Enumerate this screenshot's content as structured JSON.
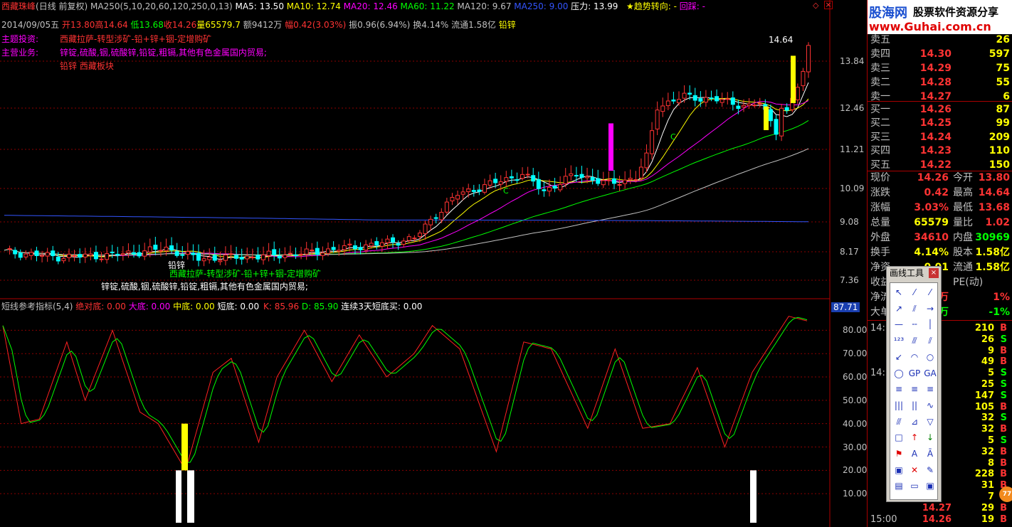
{
  "header": {
    "stock_name": "西藏珠峰",
    "period": "(日线 前复权)",
    "ma_params": "MA250(5,10,20,60,120,250,0,13)",
    "ma5": "MA5: 13.50",
    "ma10": "MA10: 12.74",
    "ma20": "MA20: 12.46",
    "ma60": "MA60: 11.22",
    "ma120": "MA120: 9.67",
    "ma250": "MA250: 9.00",
    "pressure": "压力: 13.99",
    "trend": "★趋势转向: -",
    "follow": "回踩: -"
  },
  "daybar": {
    "date": "2014/09/05五",
    "open": "开13.80",
    "high": "高14.64",
    "low": "低13.68",
    "close": "收14.26",
    "volume": "量65579.7",
    "amount": "额9412万",
    "change": "幅0.42(3.03%)",
    "amplitude": "振0.96(6.94%)",
    "turnover": "换4.14%",
    "float_cap": "流通1.58亿",
    "sector": "铅锌"
  },
  "notes": {
    "theme_label": "主题投资:",
    "theme_text": "西藏拉萨-转型涉矿-铅+锌+铟-定增购矿",
    "business_label": "主营业务:",
    "business_text": "锌锭,硫酸,铟,硫酸锌,铅锭,粗镉,其他有色金属国内贸易;",
    "blocks_text": "铅锌 西藏板块",
    "chart_tag": "铅锌",
    "chart_theme": "西藏拉萨-转型涉矿-铅+锌+铟-定增购矿",
    "chart_business": "锌锭,硫酸,铟,硫酸锌,铅锭,粗镉,其他有色金属国内贸易;",
    "peak_label": "14.64",
    "c_marker": "C"
  },
  "price_axis": {
    "ticks": [
      "13.84",
      "12.46",
      "11.21",
      "10.09",
      "9.08",
      "8.17",
      "7.36"
    ]
  },
  "indicator": {
    "name": "短线参考指标(5,4)",
    "abs_bottom": "绝对底: 0.00",
    "big_bottom": "大底: 0.00",
    "mid_bottom": "中底: 0.00",
    "short_bottom": "短底: 0.00",
    "k": "K: 85.96",
    "d": "D: 85.90",
    "buy3": "连续3天短底买: 0.00",
    "current": "87.71",
    "ticks": [
      "80.00",
      "70.00",
      "60.00",
      "50.00",
      "40.00",
      "30.00",
      "20.00",
      "10.00"
    ]
  },
  "logo": {
    "cn": "股海网",
    "slogan": "股票软件资源分享",
    "url": "www.Guhai.com.cn"
  },
  "orderbook": {
    "asks": [
      {
        "label": "卖五",
        "price": "",
        "vol": "26"
      },
      {
        "label": "卖四",
        "price": "14.30",
        "vol": "597"
      },
      {
        "label": "卖三",
        "price": "14.29",
        "vol": "75"
      },
      {
        "label": "卖二",
        "price": "14.28",
        "vol": "55"
      },
      {
        "label": "卖一",
        "price": "14.27",
        "vol": "6"
      }
    ],
    "bids": [
      {
        "label": "买一",
        "price": "14.26",
        "vol": "87"
      },
      {
        "label": "买二",
        "price": "14.25",
        "vol": "99"
      },
      {
        "label": "买三",
        "price": "14.24",
        "vol": "209"
      },
      {
        "label": "买四",
        "price": "14.23",
        "vol": "110"
      },
      {
        "label": "买五",
        "price": "14.22",
        "vol": "150"
      }
    ]
  },
  "stats": [
    {
      "l1": "现价",
      "v1": "14.26",
      "c1": "#ff3333",
      "l2": "今开",
      "v2": "13.80",
      "c2": "#ff3333"
    },
    {
      "l1": "涨跌",
      "v1": "0.42",
      "c1": "#ff3333",
      "l2": "最高",
      "v2": "14.64",
      "c2": "#ff3333"
    },
    {
      "l1": "涨幅",
      "v1": "3.03%",
      "c1": "#ff3333",
      "l2": "最低",
      "v2": "13.68",
      "c2": "#ff3333"
    },
    {
      "l1": "总量",
      "v1": "65579",
      "c1": "#ffff00",
      "l2": "量比",
      "v2": "1.02",
      "c2": "#ff3333"
    },
    {
      "l1": "外盘",
      "v1": "34610",
      "c1": "#ff3333",
      "l2": "内盘",
      "v2": "30969",
      "c2": "#00ff00"
    },
    {
      "l1": "换手",
      "v1": "4.14%",
      "c1": "#ffff00",
      "l2": "股本",
      "v2": "1.58亿",
      "c2": "#ffff00"
    },
    {
      "l1": "净资",
      "v1": "-0.01",
      "c1": "#ffff00",
      "l2": "流通",
      "v2": "1.58亿",
      "c2": "#ffff00"
    },
    {
      "l1": "收益",
      "v1": "",
      "c1": "#ffff00",
      "l2": "PE(动)",
      "v2": "",
      "c2": "#ffff00"
    },
    {
      "l1": "净流",
      "v1": "80.8万",
      "c1": "#ff3333",
      "l2": "",
      "v2": "1%",
      "c2": "#ff3333"
    },
    {
      "l1": "大单",
      "v1": "-73.8万",
      "c1": "#00ff00",
      "l2": "",
      "v2": "-1%",
      "c2": "#00ff00"
    }
  ],
  "ticks": [
    {
      "t": "14:",
      "p": "",
      "v": "210",
      "d": "B"
    },
    {
      "t": "",
      "p": "",
      "v": "26",
      "d": "S"
    },
    {
      "t": "",
      "p": "",
      "v": "9",
      "d": "B"
    },
    {
      "t": "",
      "p": "",
      "v": "49",
      "d": "B"
    },
    {
      "t": "14:",
      "p": "",
      "v": "5",
      "d": "S"
    },
    {
      "t": "",
      "p": "",
      "v": "25",
      "d": "S"
    },
    {
      "t": "",
      "p": "",
      "v": "147",
      "d": "S"
    },
    {
      "t": "",
      "p": "",
      "v": "105",
      "d": "B"
    },
    {
      "t": "",
      "p": "",
      "v": "32",
      "d": "S"
    },
    {
      "t": "",
      "p": "",
      "v": "32",
      "d": "B"
    },
    {
      "t": "",
      "p": "",
      "v": "5",
      "d": "S"
    },
    {
      "t": "",
      "p": "",
      "v": "32",
      "d": "B"
    },
    {
      "t": "",
      "p": "",
      "v": "8",
      "d": "B"
    },
    {
      "t": "",
      "p": "",
      "v": "228",
      "d": "B"
    },
    {
      "t": "",
      "p": "",
      "v": "31",
      "d": "B"
    },
    {
      "t": "",
      "p": "",
      "v": "7",
      "d": "B"
    },
    {
      "t": "",
      "p": "14.27",
      "v": "29",
      "d": "B"
    },
    {
      "t": "15:00",
      "p": "14.26",
      "v": "19",
      "d": "B"
    }
  ],
  "toolbox": {
    "title": "画线工具",
    "close": "×"
  },
  "badge": "77",
  "colors": {
    "up": "#ff3333",
    "down": "#00ffff",
    "ma5": "#ffffff",
    "ma10": "#ffff00",
    "ma20": "#ff00ff",
    "ma60": "#00ff00",
    "ma120": "#c0c0c0",
    "ma250": "#3355ff",
    "k_line": "#ff2020",
    "d_line": "#00ff00",
    "grid": "#8b0000"
  }
}
